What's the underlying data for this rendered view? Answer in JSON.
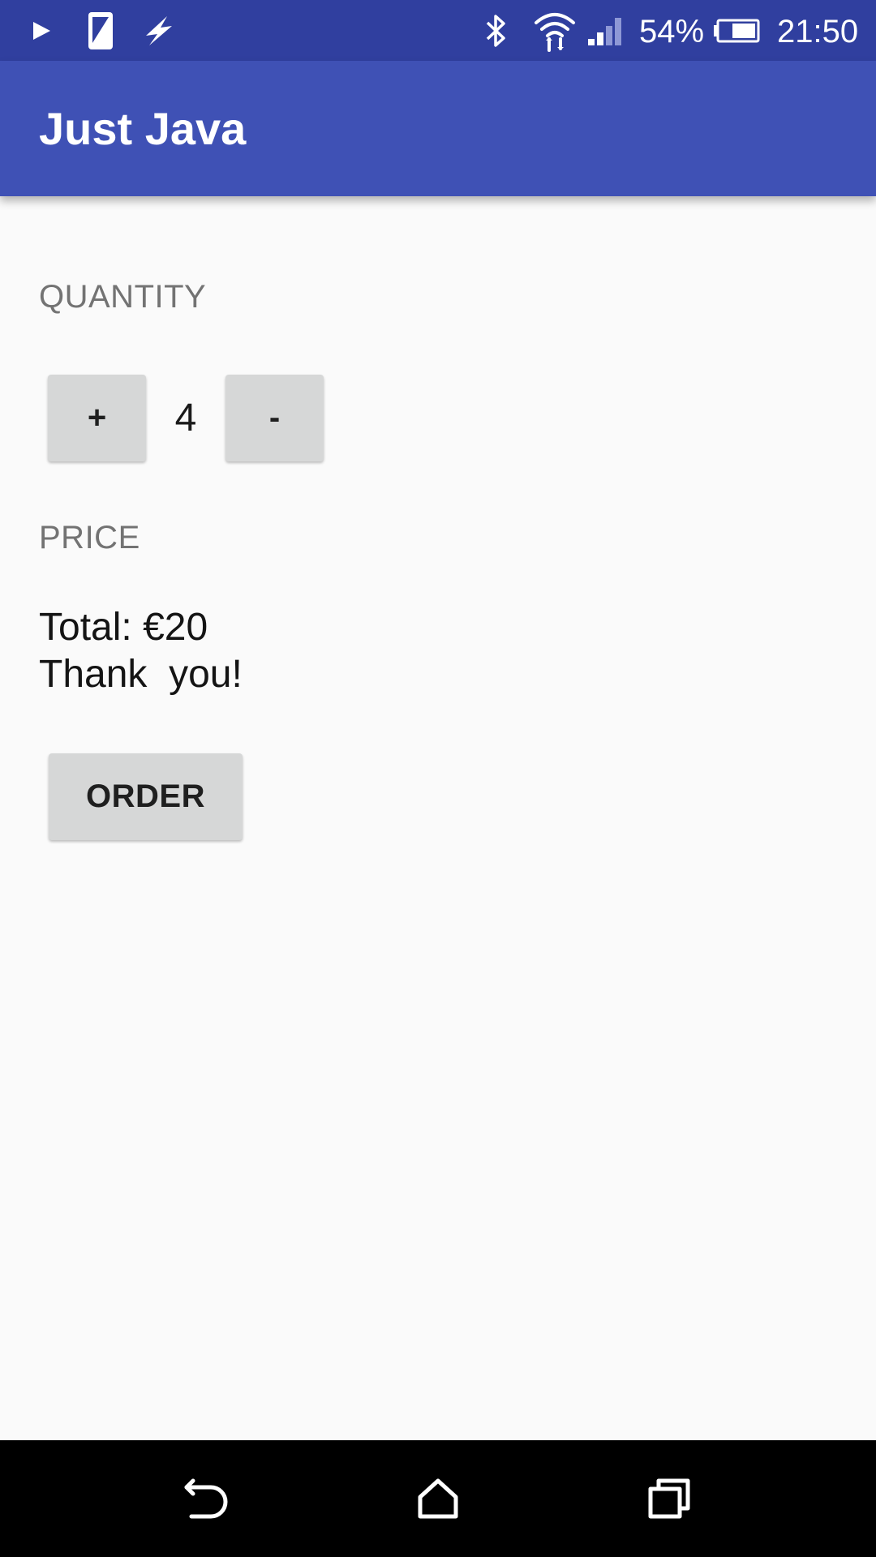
{
  "status_bar": {
    "icons": [
      "play-store-icon",
      "screenshot-icon",
      "flash-icon",
      "bluetooth-icon",
      "wifi-icon",
      "cell-signal-icon",
      "battery-icon"
    ],
    "battery_percent": "54%",
    "time": "21:50"
  },
  "app_bar": {
    "title": "Just Java"
  },
  "quantity": {
    "label": "QUANTITY",
    "increment_label": "+",
    "value": "4",
    "decrement_label": "-"
  },
  "price": {
    "label": "PRICE",
    "total_line": "Total: €20",
    "thanks_line": "Thank  you!"
  },
  "order_button": {
    "label": "ORDER"
  },
  "nav_bar": {
    "icons": [
      "back-icon",
      "home-icon",
      "recents-icon"
    ]
  },
  "colors": {
    "status_bar": "#303f9f",
    "app_bar": "#3f51b5",
    "background": "#fafafa",
    "button": "#d6d7d7",
    "label_gray": "#737373"
  }
}
